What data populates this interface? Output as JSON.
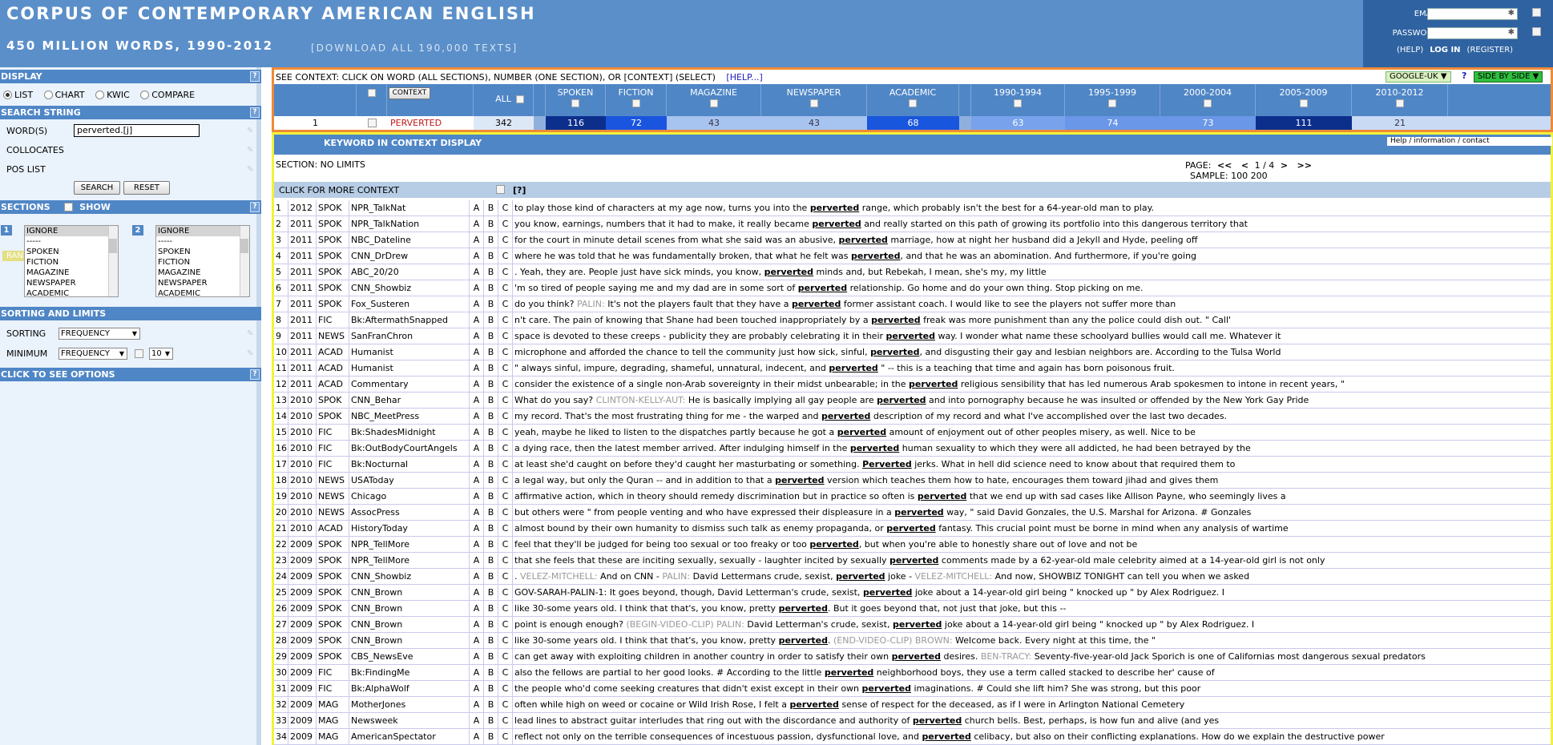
{
  "header": {
    "title": "CORPUS OF CONTEMPORARY AMERICAN ENGLISH",
    "subtitle": "450 MILLION WORDS, 1990-2012",
    "download_link": "[DOWNLOAD ALL 190,000 TEXTS]"
  },
  "login": {
    "email_label": "EMAIL",
    "password_label": "PASSWORD",
    "help": "(HELP)",
    "login": "LOG IN",
    "register": "(REGISTER)"
  },
  "sidebar": {
    "display_head": "DISPLAY",
    "display_options": [
      "LIST",
      "CHART",
      "KWIC",
      "COMPARE"
    ],
    "search_head": "SEARCH STRING",
    "words_label": "WORD(S)",
    "words_value": "perverted.[j]",
    "collocates_label": "COLLOCATES",
    "pos_label": "POS LIST",
    "random_label": "RANDOM",
    "search_btn": "SEARCH",
    "reset_btn": "RESET",
    "sections_head": "SECTIONS",
    "show_label": "SHOW",
    "section_list": [
      "IGNORE",
      "-----",
      "SPOKEN",
      "FICTION",
      "MAGAZINE",
      "NEWSPAPER",
      "ACADEMIC"
    ],
    "section1_num": "1",
    "section2_num": "2",
    "sorting_head": "SORTING AND LIMITS",
    "sorting_label": "SORTING",
    "sorting_value": "FREQUENCY",
    "minimum_label": "MINIMUM",
    "minimum_value": "FREQUENCY",
    "minimum_num": "10",
    "options_head": "CLICK TO SEE OPTIONS"
  },
  "context": {
    "instruction": "SEE CONTEXT: CLICK ON WORD (ALL SECTIONS), NUMBER (ONE SECTION), OR [CONTEXT] (SELECT)",
    "help": "[HELP...]",
    "google": "GOOGLE-UK",
    "qmark": "?",
    "sidebyside": "SIDE BY SIDE",
    "context_btn": "CONTEXT",
    "all_label": "ALL",
    "columns": [
      "SPOKEN",
      "FICTION",
      "MAGAZINE",
      "NEWSPAPER",
      "ACADEMIC",
      "1990-1994",
      "1995-1999",
      "2000-2004",
      "2005-2009",
      "2010-2012"
    ],
    "row_num": "1",
    "word": "PERVERTED",
    "all_count": "342",
    "counts": [
      "116",
      "72",
      "43",
      "43",
      "68",
      "63",
      "74",
      "73",
      "111",
      "21"
    ],
    "cell_colors": [
      "#0d2f8c",
      "#1a55e0",
      "#a7c3ef",
      "#a7c3ef",
      "#1956de",
      "#78a3ec",
      "#6a97e8",
      "#6a97e8",
      "#0d2f8c",
      "#c9daf5"
    ],
    "cell_text_colors": [
      "#ffffff",
      "#ffffff",
      "#334",
      "#334",
      "#ffffff",
      "#ffffff",
      "#ffffff",
      "#ffffff",
      "#ffffff",
      "#334"
    ]
  },
  "kwic": {
    "head": "KEYWORD IN CONTEXT DISPLAY",
    "help_links": "Help / information / contact",
    "section_label": "SECTION: NO LIMITS",
    "page_label": "PAGE:",
    "page_first": "<<",
    "page_prev": "<",
    "page_value": "1 / 4",
    "page_next": ">",
    "page_last": ">>",
    "sample_label": "SAMPLE:",
    "sample_100": "100",
    "sample_200": "200",
    "more_context": "CLICK FOR MORE CONTEXT",
    "more_q": "[?]",
    "rows": [
      {
        "n": "1",
        "year": "2012",
        "genre": "SPOK",
        "source": "NPR_TalkNat",
        "pre": "to play those kind of characters at my age now, turns you into the ",
        "kw": "perverted",
        "post": " range, which probably isn't the best for a 64-year-old man to play."
      },
      {
        "n": "2",
        "year": "2011",
        "genre": "SPOK",
        "source": "NPR_TalkNation",
        "pre": "you know, earnings, numbers that it had to make, it really became ",
        "kw": "perverted",
        "post": " and really started on this path of growing its portfolio into this dangerous territory that"
      },
      {
        "n": "3",
        "year": "2011",
        "genre": "SPOK",
        "source": "NBC_Dateline",
        "pre": "for the court in minute detail scenes from what she said was an abusive, ",
        "kw": "perverted",
        "post": " marriage, how at night her husband did a Jekyll and Hyde, peeling off"
      },
      {
        "n": "4",
        "year": "2011",
        "genre": "SPOK",
        "source": "CNN_DrDrew",
        "pre": "where he was told that he was fundamentally broken, that what he felt was ",
        "kw": "perverted",
        "post": ", and that he was an abomination. And furthermore, if you're going"
      },
      {
        "n": "5",
        "year": "2011",
        "genre": "SPOK",
        "source": "ABC_20/20",
        "pre": ". Yeah, they are. People just have sick minds, you know, ",
        "kw": "perverted",
        "post": " minds and, but Rebekah, I mean, she's my, my little"
      },
      {
        "n": "6",
        "year": "2011",
        "genre": "SPOK",
        "source": "CNN_Showbiz",
        "pre": "'m so tired of people saying me and my dad are in some sort of ",
        "kw": "perverted",
        "post": " relationship. Go home and do your own thing. Stop picking on me."
      },
      {
        "n": "7",
        "year": "2011",
        "genre": "SPOK",
        "source": "Fox_Susteren",
        "pre": "do you think? ",
        "spk": "PALIN:",
        "pre2": " It's not the players fault that they have a ",
        "kw": "perverted",
        "post": " former assistant coach. I would like to see the players not suffer more than"
      },
      {
        "n": "8",
        "year": "2011",
        "genre": "FIC",
        "source": "Bk:AftermathSnapped",
        "pre": "n't care. The pain of knowing that Shane had been touched inappropriately by a ",
        "kw": "perverted",
        "post": " freak was more punishment than any the police could dish out. \" Call'"
      },
      {
        "n": "9",
        "year": "2011",
        "genre": "NEWS",
        "source": "SanFranChron",
        "pre": "space is devoted to these creeps - publicity they are probably celebrating it in their ",
        "kw": "perverted",
        "post": " way. I wonder what name these schoolyard bullies would call me. Whatever it"
      },
      {
        "n": "10",
        "year": "2011",
        "genre": "ACAD",
        "source": "Humanist",
        "pre": "microphone and afforded the chance to tell the community just how sick, sinful, ",
        "kw": "perverted",
        "post": ", and disgusting their gay and lesbian neighbors are. According to the Tulsa World"
      },
      {
        "n": "11",
        "year": "2011",
        "genre": "ACAD",
        "source": "Humanist",
        "pre": "\" always sinful, impure, degrading, shameful, unnatural, indecent, and ",
        "kw": "perverted",
        "post": " \" -- this is a teaching that time and again has born poisonous fruit."
      },
      {
        "n": "12",
        "year": "2011",
        "genre": "ACAD",
        "source": "Commentary",
        "pre": "consider the existence of a single non-Arab sovereignty in their midst unbearable; in the ",
        "kw": "perverted",
        "post": " religious sensibility that has led numerous Arab spokesmen to intone in recent years, \""
      },
      {
        "n": "13",
        "year": "2010",
        "genre": "SPOK",
        "source": "CNN_Behar",
        "pre": "What do you say? ",
        "spk": "CLINTON-KELLY-AUT:",
        "pre2": " He is basically implying all gay people are ",
        "kw": "perverted",
        "post": " and into pornography because he was insulted or offended by the New York Gay Pride"
      },
      {
        "n": "14",
        "year": "2010",
        "genre": "SPOK",
        "source": "NBC_MeetPress",
        "pre": "my record. That's the most frustrating thing for me - the warped and ",
        "kw": "perverted",
        "post": " description of my record and what I've accomplished over the last two decades."
      },
      {
        "n": "15",
        "year": "2010",
        "genre": "FIC",
        "source": "Bk:ShadesMidnight",
        "pre": "yeah, maybe he liked to listen to the dispatches partly because he got a ",
        "kw": "perverted",
        "post": " amount of enjoyment out of other peoples misery, as well. Nice to be"
      },
      {
        "n": "16",
        "year": "2010",
        "genre": "FIC",
        "source": "Bk:OutBodyCourtAngels",
        "pre": "a dying race, then the latest member arrived. After indulging himself in the ",
        "kw": "perverted",
        "post": " human sexuality to which they were all addicted, he had been betrayed by the"
      },
      {
        "n": "17",
        "year": "2010",
        "genre": "FIC",
        "source": "Bk:Nocturnal",
        "pre": "at least she'd caught on before they'd caught her masturbating or something. ",
        "kw": "Perverted",
        "post": " jerks. What in hell did science need to know about that required them to"
      },
      {
        "n": "18",
        "year": "2010",
        "genre": "NEWS",
        "source": "USAToday",
        "pre": "a legal way, but only the Quran -- and in addition to that a ",
        "kw": "perverted",
        "post": " version which teaches them how to hate, encourages them toward jihad and gives them"
      },
      {
        "n": "19",
        "year": "2010",
        "genre": "NEWS",
        "source": "Chicago",
        "pre": "affirmative action, which in theory should remedy discrimination but in practice so often is ",
        "kw": "perverted",
        "post": " that we end up with sad cases like Allison Payne, who seemingly lives a"
      },
      {
        "n": "20",
        "year": "2010",
        "genre": "NEWS",
        "source": "AssocPress",
        "pre": "but others were \" from people venting and who have expressed their displeasure in a ",
        "kw": "perverted",
        "post": " way, \" said David Gonzales, the U.S. Marshal for Arizona. # Gonzales"
      },
      {
        "n": "21",
        "year": "2010",
        "genre": "ACAD",
        "source": "HistoryToday",
        "pre": "almost bound by their own humanity to dismiss such talk as enemy propaganda, or ",
        "kw": "perverted",
        "post": " fantasy. This crucial point must be borne in mind when any analysis of wartime"
      },
      {
        "n": "22",
        "year": "2009",
        "genre": "SPOK",
        "source": "NPR_TellMore",
        "pre": "feel that they'll be judged for being too sexual or too freaky or too ",
        "kw": "perverted",
        "post": ", but when you're able to honestly share out of love and not be"
      },
      {
        "n": "23",
        "year": "2009",
        "genre": "SPOK",
        "source": "NPR_TellMore",
        "pre": "that she feels that these are inciting sexually, sexually - laughter incited by sexually ",
        "kw": "perverted",
        "post": " comments made by a 62-year-old male celebrity aimed at a 14-year-old girl is not only"
      },
      {
        "n": "24",
        "year": "2009",
        "genre": "SPOK",
        "source": "CNN_Showbiz",
        "pre": ". ",
        "spk": "VELEZ-MITCHELL:",
        "pre2": " And on CNN - ",
        "spk2": "PALIN:",
        "pre3": " David Lettermans crude, sexist, ",
        "kw": "perverted",
        "post": " joke - ",
        "spk3": "VELEZ-MITCHELL:",
        "post2": " And now, SHOWBIZ TONIGHT can tell you when we asked"
      },
      {
        "n": "25",
        "year": "2009",
        "genre": "SPOK",
        "source": "CNN_Brown",
        "pre": "GOV-SARAH-PALIN-1: It goes beyond, though, David Letterman's crude, sexist, ",
        "kw": "perverted",
        "post": " joke about a 14-year-old girl being \" knocked up \" by Alex Rodriguez. I"
      },
      {
        "n": "26",
        "year": "2009",
        "genre": "SPOK",
        "source": "CNN_Brown",
        "pre": "like 30-some years old. I think that that's, you know, pretty ",
        "kw": "perverted",
        "post": ". But it goes beyond that, not just that joke, but this --"
      },
      {
        "n": "27",
        "year": "2009",
        "genre": "SPOK",
        "source": "CNN_Brown",
        "pre": "point is enough enough? ",
        "spk": "(BEGIN-VIDEO-CLIP) PALIN:",
        "pre2": " David Letterman's crude, sexist, ",
        "kw": "perverted",
        "post": " joke about a 14-year-old girl being \" knocked up \" by Alex Rodriguez. I"
      },
      {
        "n": "28",
        "year": "2009",
        "genre": "SPOK",
        "source": "CNN_Brown",
        "pre": "like 30-some years old. I think that that's, you know, pretty ",
        "kw": "perverted",
        "post": ". ",
        "spk3": "(END-VIDEO-CLIP) BROWN:",
        "post2": " Welcome back. Every night at this time, the \""
      },
      {
        "n": "29",
        "year": "2009",
        "genre": "SPOK",
        "source": "CBS_NewsEve",
        "pre": "can get away with exploiting children in another country in order to satisfy their own ",
        "kw": "perverted",
        "post": " desires. ",
        "spk3": "BEN-TRACY:",
        "post2": " Seventy-five-year-old Jack Sporich is one of Californias most dangerous sexual predators"
      },
      {
        "n": "30",
        "year": "2009",
        "genre": "FIC",
        "source": "Bk:FindingMe",
        "pre": "also the fellows are partial to her good looks. # According to the little ",
        "kw": "perverted",
        "post": " neighborhood boys, they use a term called stacked to describe her' cause of"
      },
      {
        "n": "31",
        "year": "2009",
        "genre": "FIC",
        "source": "Bk:AlphaWolf",
        "pre": "the people who'd come seeking creatures that didn't exist except in their own ",
        "kw": "perverted",
        "post": " imaginations. # Could she lift him? She was strong, but this poor"
      },
      {
        "n": "32",
        "year": "2009",
        "genre": "MAG",
        "source": "MotherJones",
        "pre": "often while high on weed or cocaine or Wild Irish Rose, I felt a ",
        "kw": "perverted",
        "post": " sense of respect for the deceased, as if I were in Arlington National Cemetery"
      },
      {
        "n": "33",
        "year": "2009",
        "genre": "MAG",
        "source": "Newsweek",
        "pre": "lead lines to abstract guitar interludes that ring out with the discordance and authority of ",
        "kw": "perverted",
        "post": " church bells. Best, perhaps, is how fun and alive (and yes"
      },
      {
        "n": "34",
        "year": "2009",
        "genre": "MAG",
        "source": "AmericanSpectator",
        "pre": "reflect not only on the terrible consequences of incestuous passion, dysfunctional love, and ",
        "kw": "perverted",
        "post": " celibacy, but also on their conflicting explanations. How do we explain the destructive power"
      }
    ]
  }
}
